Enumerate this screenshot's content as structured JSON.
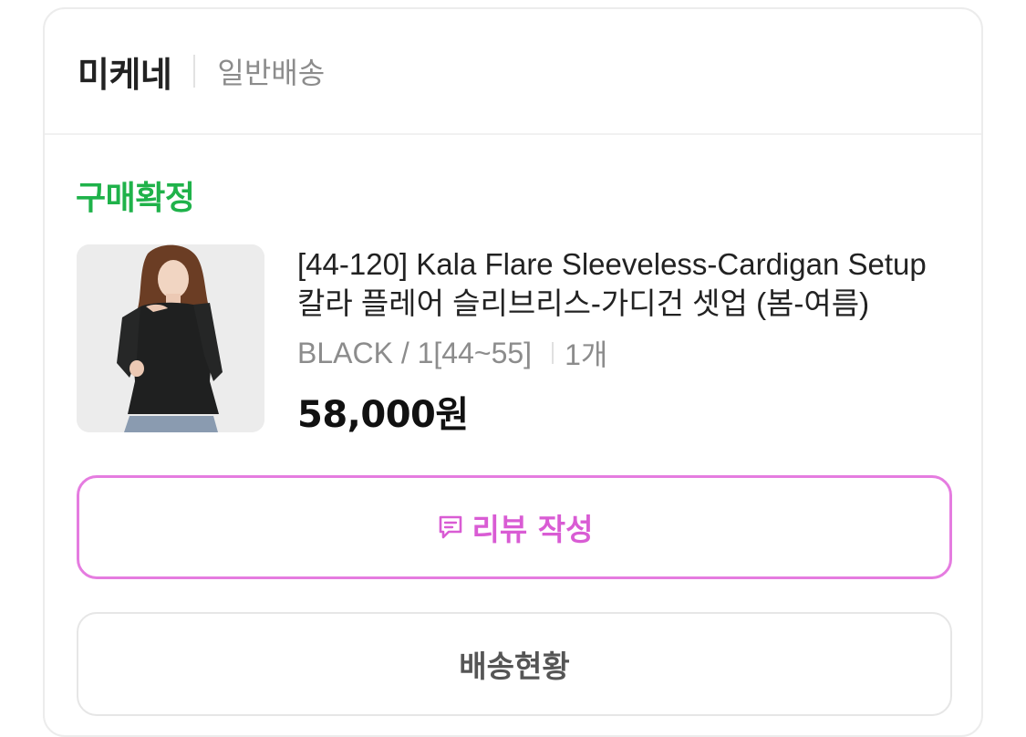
{
  "header": {
    "seller_name": "미케네",
    "shipping_type": "일반배송"
  },
  "order": {
    "status": "구매확정",
    "status_color": "#1fb24a",
    "product_title": "[44-120] Kala Flare Sleeveless-Cardigan Setup 칼라 플레어 슬리브리스-가디건 셋업 (봄-여름)",
    "option": "BLACK / 1[44~55]",
    "quantity": "1개",
    "price": "58,000원"
  },
  "actions": {
    "review_label": "리뷰 작성",
    "review_color": "#e57ce0",
    "shipping_status_label": "배송현황"
  },
  "icons": {
    "review": "review-speech-icon"
  }
}
